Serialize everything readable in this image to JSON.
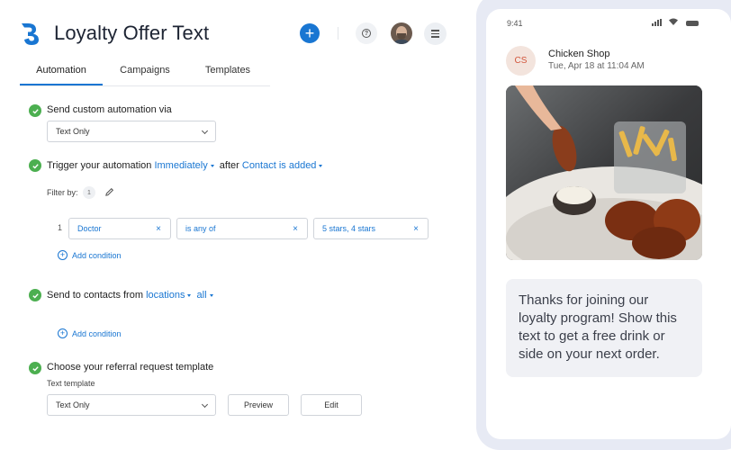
{
  "header": {
    "title": "Loyalty Offer Text",
    "logo_icon": "brand-logo-icon",
    "plus_icon": "+",
    "help_icon": "?",
    "accent_color": "#1976d2"
  },
  "tabs": [
    {
      "label": "Automation",
      "active": true
    },
    {
      "label": "Campaigns",
      "active": false
    },
    {
      "label": "Templates",
      "active": false
    }
  ],
  "steps": {
    "send_via": {
      "label": "Send custom automation via",
      "select_value": "Text Only"
    },
    "trigger": {
      "label_prefix": "Trigger your automation",
      "timing": "Immediately",
      "after_text": "after",
      "event": "Contact is added",
      "filter_label": "Filter by:",
      "filter_count": "1",
      "condition": {
        "index": "1",
        "field": "Doctor",
        "operator": "is any of",
        "value": "5 stars, 4 stars",
        "remove_icon": "×"
      },
      "add_condition": "Add condition"
    },
    "contacts": {
      "label_prefix": "Send to contacts from",
      "source": "locations",
      "scope": "all",
      "add_condition": "Add condition"
    },
    "template": {
      "label": "Choose your referral request template",
      "sublabel": "Text template",
      "select_value": "Text Only",
      "preview_label": "Preview",
      "edit_label": "Edit"
    },
    "check_color": "#4caf50"
  },
  "phone": {
    "time": "9:41",
    "sender_initials": "CS",
    "sender_name": "Chicken Shop",
    "sent_at": "Tue, Apr 18 at 11:04 AM",
    "message": "Thanks for joining our loyalty program! Show this text to get a free drink or side on your next order."
  }
}
